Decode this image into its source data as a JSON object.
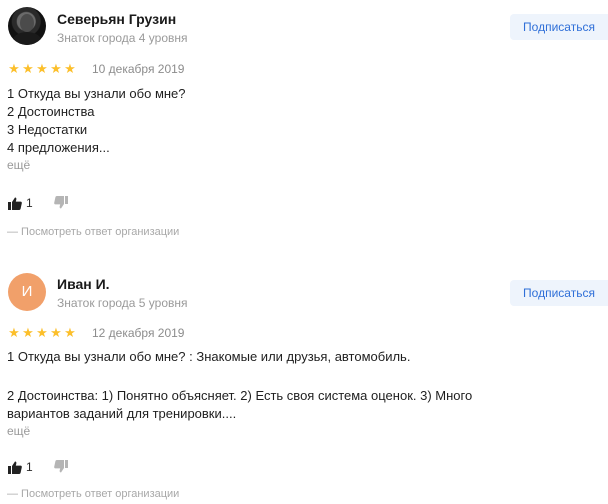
{
  "reviews": [
    {
      "author": {
        "name": "Северьян Грузин",
        "level": "Знаток города 4 уровня",
        "avatar_letter": ""
      },
      "subscribe_label": "Подписаться",
      "rating": 5,
      "date": "10 декабря 2019",
      "text_lines": [
        "1 Откуда вы узнали обо мне?",
        "2 Достоинства",
        "3 Недостатки",
        "4 предложения..."
      ],
      "more_label": "ещё",
      "likes": "1",
      "org_reply_label": "— Посмотреть ответ организации"
    },
    {
      "author": {
        "name": "Иван И.",
        "level": "Знаток города 5 уровня",
        "avatar_letter": "И"
      },
      "subscribe_label": "Подписаться",
      "rating": 5,
      "date": "12 декабря 2019",
      "text_lines": [
        "1 Откуда вы узнали обо мне? : Знакомые или друзья, автомобиль.",
        "",
        "2 Достоинства: 1) Понятно объясняет. 2) Есть своя система оценок. 3) Много",
        "вариантов заданий для тренировки...."
      ],
      "more_label": "ещё",
      "likes": "1",
      "org_reply_label": "— Посмотреть ответ организации"
    }
  ],
  "colors": {
    "star": "#fcbf2b",
    "accent": "#2f6fd8",
    "subscribe_bg": "#eef4fc",
    "avatar_letter_bg": "#f1a06a"
  }
}
